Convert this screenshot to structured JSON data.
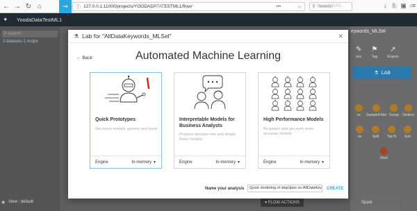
{
  "browser": {
    "url": "127.0.0.1:11000/projects/YOODADATATESTML1/flow/",
    "search_placeholder": "Search",
    "ellipsis": "•••"
  },
  "appbar": {
    "project_name": "YoodaDataTestML1",
    "flow_label": "Flow",
    "search_placeholder": "Search DSS..."
  },
  "left": {
    "search_placeholder": "Search",
    "count_text": "3 datasets 1 recipe",
    "view_label": "View : default"
  },
  "right": {
    "title": "eywords_MLSel",
    "tools": [
      {
        "icon": "edit-icon",
        "label": "ore"
      },
      {
        "icon": "tag-icon",
        "label": "Tag"
      },
      {
        "icon": "export-icon",
        "label": "Export"
      }
    ],
    "lab_label": "LAB",
    "recipes": [
      [
        "ec",
        "Sample/Filter",
        "Group",
        "Distinct"
      ],
      [
        "ne",
        "Split",
        "Top N",
        "Sort"
      ]
    ],
    "shell_label": "Shell",
    "bottom_label": "Spark"
  },
  "flow_actions": "FLOW ACTIONS",
  "modal": {
    "title": "Lab for \"AllDataKeywords_MLSel\"",
    "back_label": "Back",
    "heading": "Automated Machine Learning",
    "cards": [
      {
        "title": "Quick Prototypes",
        "desc": "Get some models, generic and quick.",
        "engine_label": "Engine",
        "engine_value": "In-memory"
      },
      {
        "title": "Interpretable Models for Business Analysts",
        "desc": "Produce decision tree and simple linear models.",
        "engine_label": "Engine",
        "engine_value": "In-memory"
      },
      {
        "title": "High Performance Models",
        "desc": "Be patient and get even more accurate models.",
        "engine_label": "Engine",
        "engine_value": "In-memory"
      }
    ],
    "name_label": "Name your analysis",
    "name_value": "Quick modeling of idop3pos on AllDataKeyv",
    "create_label": "CREATE"
  },
  "colors": {
    "accent": "#2aa7df",
    "selected_border": "#7fbde3",
    "annotation_mark": "#e0201a"
  }
}
